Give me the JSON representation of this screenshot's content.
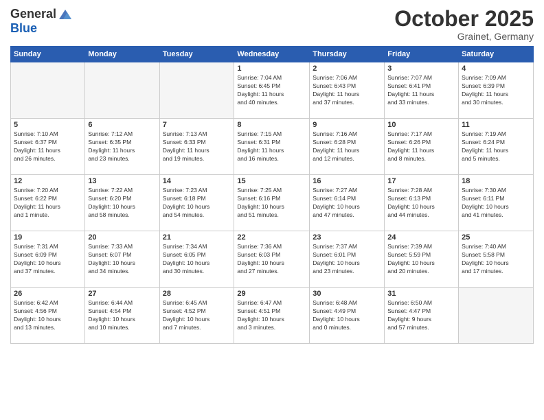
{
  "logo": {
    "general": "General",
    "blue": "Blue"
  },
  "title": "October 2025",
  "location": "Grainet, Germany",
  "weekdays": [
    "Sunday",
    "Monday",
    "Tuesday",
    "Wednesday",
    "Thursday",
    "Friday",
    "Saturday"
  ],
  "weeks": [
    [
      {
        "day": "",
        "info": "",
        "empty": true
      },
      {
        "day": "",
        "info": "",
        "empty": true
      },
      {
        "day": "",
        "info": "",
        "empty": true
      },
      {
        "day": "1",
        "info": "Sunrise: 7:04 AM\nSunset: 6:45 PM\nDaylight: 11 hours\nand 40 minutes."
      },
      {
        "day": "2",
        "info": "Sunrise: 7:06 AM\nSunset: 6:43 PM\nDaylight: 11 hours\nand 37 minutes."
      },
      {
        "day": "3",
        "info": "Sunrise: 7:07 AM\nSunset: 6:41 PM\nDaylight: 11 hours\nand 33 minutes."
      },
      {
        "day": "4",
        "info": "Sunrise: 7:09 AM\nSunset: 6:39 PM\nDaylight: 11 hours\nand 30 minutes."
      }
    ],
    [
      {
        "day": "5",
        "info": "Sunrise: 7:10 AM\nSunset: 6:37 PM\nDaylight: 11 hours\nand 26 minutes."
      },
      {
        "day": "6",
        "info": "Sunrise: 7:12 AM\nSunset: 6:35 PM\nDaylight: 11 hours\nand 23 minutes."
      },
      {
        "day": "7",
        "info": "Sunrise: 7:13 AM\nSunset: 6:33 PM\nDaylight: 11 hours\nand 19 minutes."
      },
      {
        "day": "8",
        "info": "Sunrise: 7:15 AM\nSunset: 6:31 PM\nDaylight: 11 hours\nand 16 minutes."
      },
      {
        "day": "9",
        "info": "Sunrise: 7:16 AM\nSunset: 6:28 PM\nDaylight: 11 hours\nand 12 minutes."
      },
      {
        "day": "10",
        "info": "Sunrise: 7:17 AM\nSunset: 6:26 PM\nDaylight: 11 hours\nand 8 minutes."
      },
      {
        "day": "11",
        "info": "Sunrise: 7:19 AM\nSunset: 6:24 PM\nDaylight: 11 hours\nand 5 minutes."
      }
    ],
    [
      {
        "day": "12",
        "info": "Sunrise: 7:20 AM\nSunset: 6:22 PM\nDaylight: 11 hours\nand 1 minute."
      },
      {
        "day": "13",
        "info": "Sunrise: 7:22 AM\nSunset: 6:20 PM\nDaylight: 10 hours\nand 58 minutes."
      },
      {
        "day": "14",
        "info": "Sunrise: 7:23 AM\nSunset: 6:18 PM\nDaylight: 10 hours\nand 54 minutes."
      },
      {
        "day": "15",
        "info": "Sunrise: 7:25 AM\nSunset: 6:16 PM\nDaylight: 10 hours\nand 51 minutes."
      },
      {
        "day": "16",
        "info": "Sunrise: 7:27 AM\nSunset: 6:14 PM\nDaylight: 10 hours\nand 47 minutes."
      },
      {
        "day": "17",
        "info": "Sunrise: 7:28 AM\nSunset: 6:13 PM\nDaylight: 10 hours\nand 44 minutes."
      },
      {
        "day": "18",
        "info": "Sunrise: 7:30 AM\nSunset: 6:11 PM\nDaylight: 10 hours\nand 41 minutes."
      }
    ],
    [
      {
        "day": "19",
        "info": "Sunrise: 7:31 AM\nSunset: 6:09 PM\nDaylight: 10 hours\nand 37 minutes."
      },
      {
        "day": "20",
        "info": "Sunrise: 7:33 AM\nSunset: 6:07 PM\nDaylight: 10 hours\nand 34 minutes."
      },
      {
        "day": "21",
        "info": "Sunrise: 7:34 AM\nSunset: 6:05 PM\nDaylight: 10 hours\nand 30 minutes."
      },
      {
        "day": "22",
        "info": "Sunrise: 7:36 AM\nSunset: 6:03 PM\nDaylight: 10 hours\nand 27 minutes."
      },
      {
        "day": "23",
        "info": "Sunrise: 7:37 AM\nSunset: 6:01 PM\nDaylight: 10 hours\nand 23 minutes."
      },
      {
        "day": "24",
        "info": "Sunrise: 7:39 AM\nSunset: 5:59 PM\nDaylight: 10 hours\nand 20 minutes."
      },
      {
        "day": "25",
        "info": "Sunrise: 7:40 AM\nSunset: 5:58 PM\nDaylight: 10 hours\nand 17 minutes."
      }
    ],
    [
      {
        "day": "26",
        "info": "Sunrise: 6:42 AM\nSunset: 4:56 PM\nDaylight: 10 hours\nand 13 minutes."
      },
      {
        "day": "27",
        "info": "Sunrise: 6:44 AM\nSunset: 4:54 PM\nDaylight: 10 hours\nand 10 minutes."
      },
      {
        "day": "28",
        "info": "Sunrise: 6:45 AM\nSunset: 4:52 PM\nDaylight: 10 hours\nand 7 minutes."
      },
      {
        "day": "29",
        "info": "Sunrise: 6:47 AM\nSunset: 4:51 PM\nDaylight: 10 hours\nand 3 minutes."
      },
      {
        "day": "30",
        "info": "Sunrise: 6:48 AM\nSunset: 4:49 PM\nDaylight: 10 hours\nand 0 minutes."
      },
      {
        "day": "31",
        "info": "Sunrise: 6:50 AM\nSunset: 4:47 PM\nDaylight: 9 hours\nand 57 minutes."
      },
      {
        "day": "",
        "info": "",
        "empty": true
      }
    ]
  ]
}
